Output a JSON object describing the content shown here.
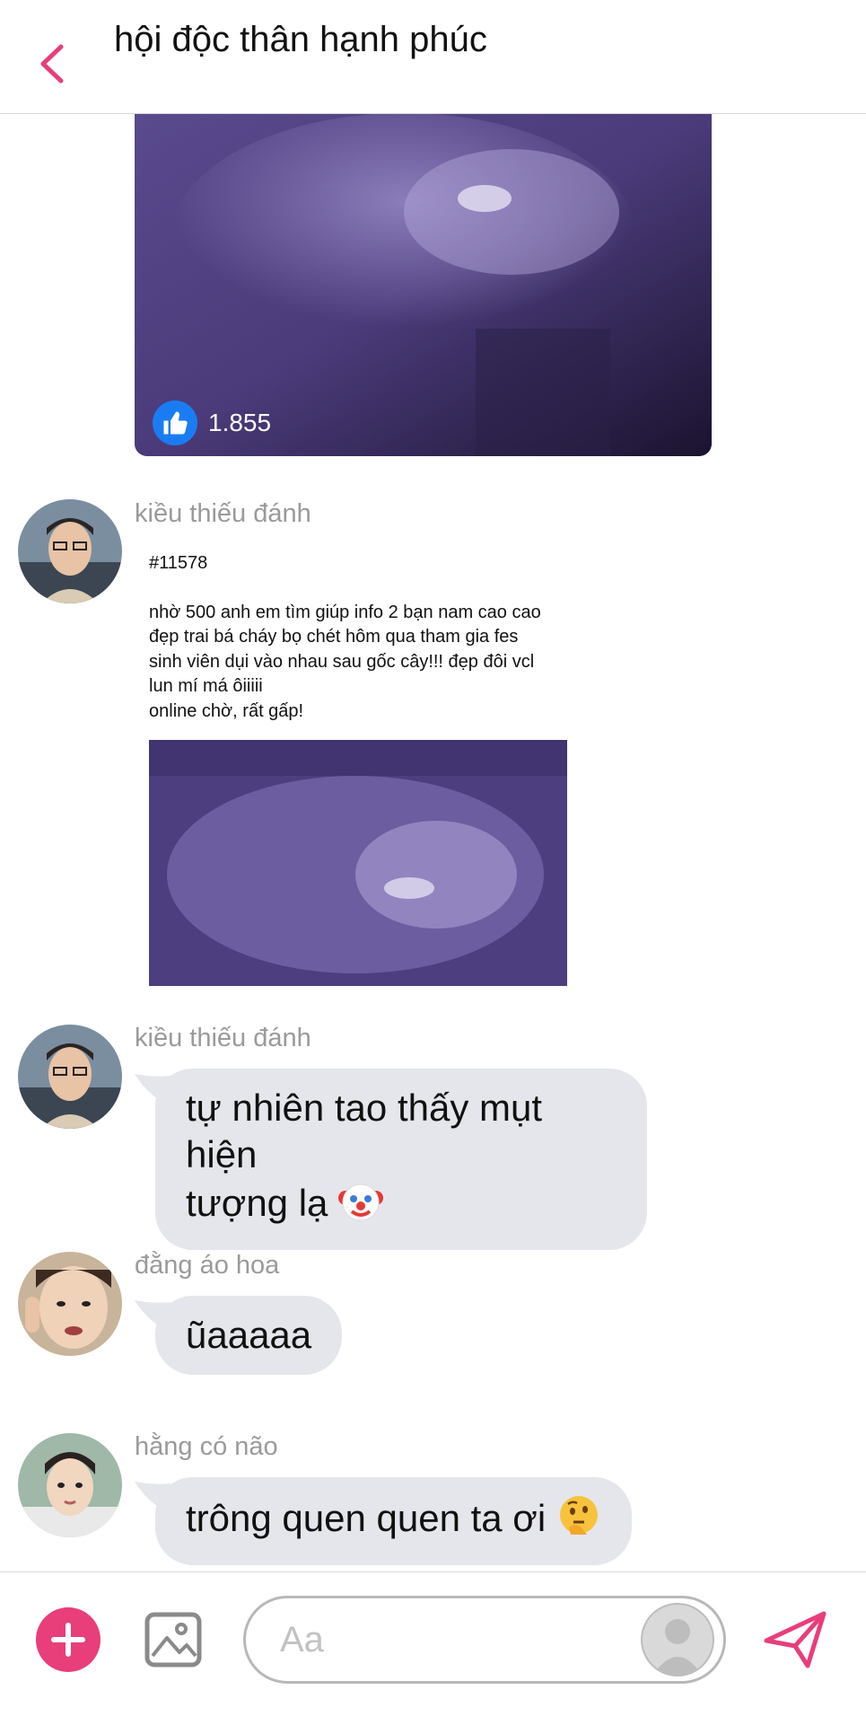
{
  "header": {
    "title": "hội độc thân hạnh phúc",
    "back_icon": "chevron-left-icon",
    "accent_color": "#e83e7a"
  },
  "top_media": {
    "like_count": "1.855",
    "like_icon": "thumbs-up-icon"
  },
  "messages": [
    {
      "sender": "kiều thiếu đánh",
      "post": {
        "id": "#11578",
        "body": "nhờ 500 anh em tìm giúp info 2 bạn nam cao cao\nđẹp trai bá cháy bọ chét hôm qua tham gia fes\nsinh viên dụi vào nhau sau gốc cây!!! đẹp đôi vcl\nlun mí má ôiiiii\nonline chờ, rất gấp!"
      }
    },
    {
      "sender": "kiều thiếu đánh",
      "text": "tự nhiên tao thấy mụt hiện\ntượng lạ",
      "emoji": "clown-face-icon"
    },
    {
      "sender": "đằng áo hoa",
      "text": "ũaaaaa"
    },
    {
      "sender": "hằng có não",
      "text": "trông quen quen ta ơi",
      "emoji": "thinking-face-icon"
    }
  ],
  "composer": {
    "placeholder": "Aa",
    "add_icon": "plus-icon",
    "gallery_icon": "image-icon",
    "avatar_icon": "user-silhouette-icon",
    "send_icon": "send-icon"
  }
}
